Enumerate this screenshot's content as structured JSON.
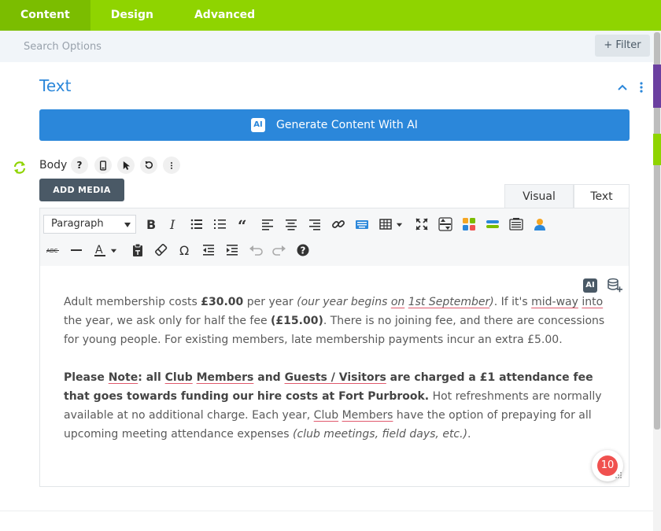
{
  "tabs": [
    {
      "label": "Content",
      "active": true
    },
    {
      "label": "Design",
      "active": false
    },
    {
      "label": "Advanced",
      "active": false
    }
  ],
  "search": {
    "placeholder": "Search Options",
    "filter_label": "Filter"
  },
  "section": {
    "title": "Text"
  },
  "ai_button": {
    "badge": "AI",
    "label": "Generate Content With AI"
  },
  "body_field": {
    "label": "Body",
    "help": "?"
  },
  "add_media": "ADD MEDIA",
  "editor_tabs": {
    "visual": "Visual",
    "text": "Text"
  },
  "toolbar": {
    "format_select": "Paragraph",
    "text_color_letter": "A",
    "strike_label": "ABC"
  },
  "editor_ai_badge": "AI",
  "content": {
    "p1": {
      "t1": "Adult membership costs ",
      "b1": "£30.00",
      "t2": " per year ",
      "i1a": "(our year begins ",
      "i1b": "on",
      "i1c": " ",
      "i1d": "1st September",
      "i1e": ")",
      "t3": ". If it's ",
      "s1": "mid-way",
      "t4": " ",
      "s2": "into",
      "t5": " the year, we ask only for half the fee ",
      "b2": "(£15.00)",
      "t6": ". There is no joining fee, and there are concessions for young people. For existing members, late membership payments incur an extra £5.00."
    },
    "p2": {
      "b1": "Please ",
      "b2": "Note",
      "b3": ": all ",
      "b4": "Club",
      "b5": " ",
      "b6": "Members",
      "b7": " and ",
      "b8": "Guests / Visitors",
      "b9": " are charged a £1 attendance fee that goes towards funding our hire costs at Fort Purbrook.",
      "t1": " Hot refreshments are normally available at no additional charge. Each year, ",
      "s1": "Club",
      "t2": " ",
      "s2": "Members",
      "t3": " have the option of prepaying for all upcoming meeting attendance expenses ",
      "i1": "(club meetings, field days, etc.)",
      "t4": "."
    }
  },
  "notification_count": "10",
  "colors": {
    "green": "#8fd400",
    "blue": "#2b87da",
    "dark": "#4a5966",
    "red": "#f0514f"
  }
}
